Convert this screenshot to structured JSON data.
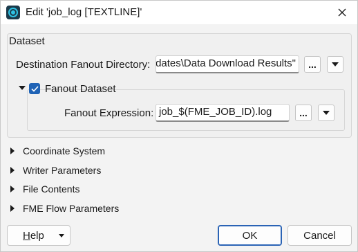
{
  "window": {
    "title": "Edit 'job_log [TEXTLINE]'",
    "icon": "fme-workbench-app-icon"
  },
  "dataset_group": {
    "title": "Dataset",
    "destination": {
      "label": "Destination Fanout Directory:",
      "value": "dates\\Data Download Results\"",
      "browse_label": "..."
    },
    "fanout": {
      "label": "Fanout Dataset",
      "checked": true,
      "expanded": true,
      "expression_label": "Fanout Expression:",
      "expression_value": "job_$(FME_JOB_ID).log",
      "browse_label": "..."
    }
  },
  "sections": [
    {
      "label": "Coordinate System",
      "expanded": false
    },
    {
      "label": "Writer Parameters",
      "expanded": false
    },
    {
      "label": "File Contents",
      "expanded": false
    },
    {
      "label": "FME Flow Parameters",
      "expanded": false
    }
  ],
  "footer": {
    "help_label": "Help",
    "ok_label": "OK",
    "cancel_label": "Cancel"
  },
  "colors": {
    "accent": "#1f63b6",
    "icon_bg": "#1b3a4b",
    "icon_ring": "#2ec4e6"
  }
}
